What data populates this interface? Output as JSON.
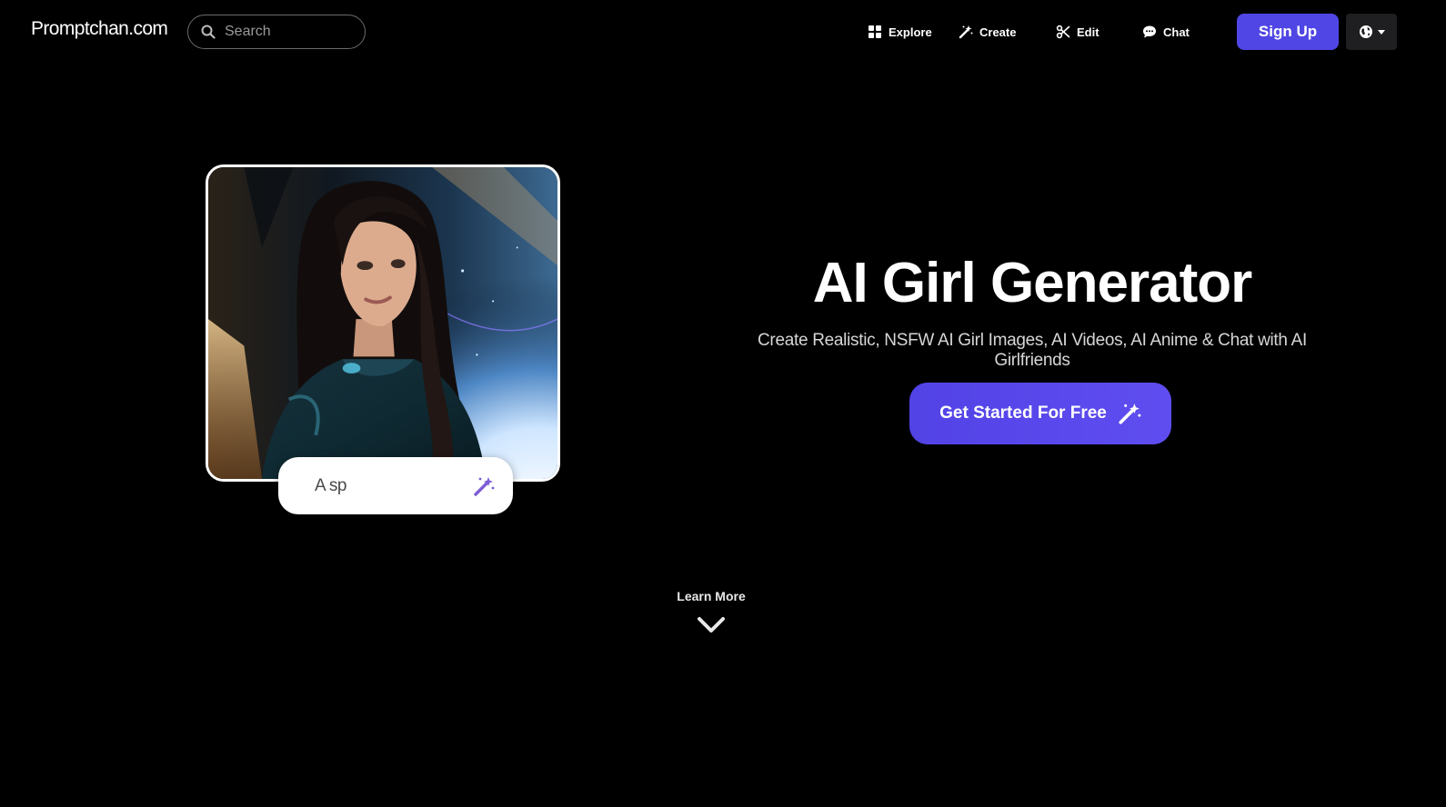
{
  "header": {
    "logo": "Promptchan.com",
    "search_placeholder": "Search",
    "nav": [
      {
        "label": "Explore",
        "icon": "grid-icon"
      },
      {
        "label": "Create",
        "icon": "magic-wand-icon"
      },
      {
        "label": "Edit",
        "icon": "scissors-icon"
      },
      {
        "label": "Chat",
        "icon": "chat-bubble-icon"
      }
    ],
    "signup_label": "Sign Up",
    "language_icon": "globe-icon"
  },
  "hero": {
    "title": "AI Girl Generator",
    "subtitle": "Create Realistic, NSFW AI Girl Images, AI Videos, AI Anime & Chat with AI Girlfriends",
    "cta_label": "Get Started For Free"
  },
  "preview": {
    "prompt_text": "A sp"
  },
  "learn_more": {
    "label": "Learn More"
  },
  "colors": {
    "accent": "#4f46e5",
    "background": "#000000",
    "wand_purple": "#7c5cd6"
  }
}
